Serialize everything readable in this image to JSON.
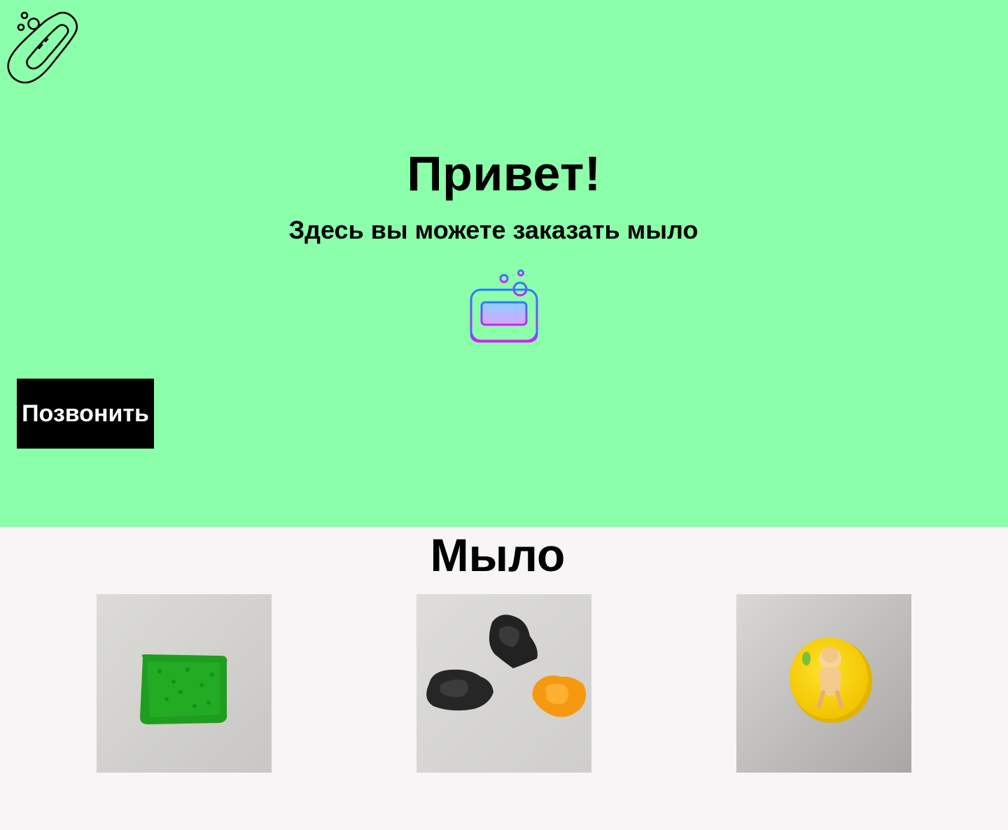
{
  "hero": {
    "logo_icon": "soap-bar-outline-icon",
    "title": "Привет!",
    "subtitle": "Здесь вы можете заказать мыло",
    "soap_icon": "soap-dish-gradient-icon",
    "call_button_label": "Позвонить",
    "background_color": "#8bffa9"
  },
  "products": {
    "title": "Мыло",
    "items": [
      {
        "photo": "green-rectangular-soap"
      },
      {
        "photo": "black-and-orange-figure-soaps"
      },
      {
        "photo": "yellow-round-soap-with-child-picture"
      }
    ]
  }
}
